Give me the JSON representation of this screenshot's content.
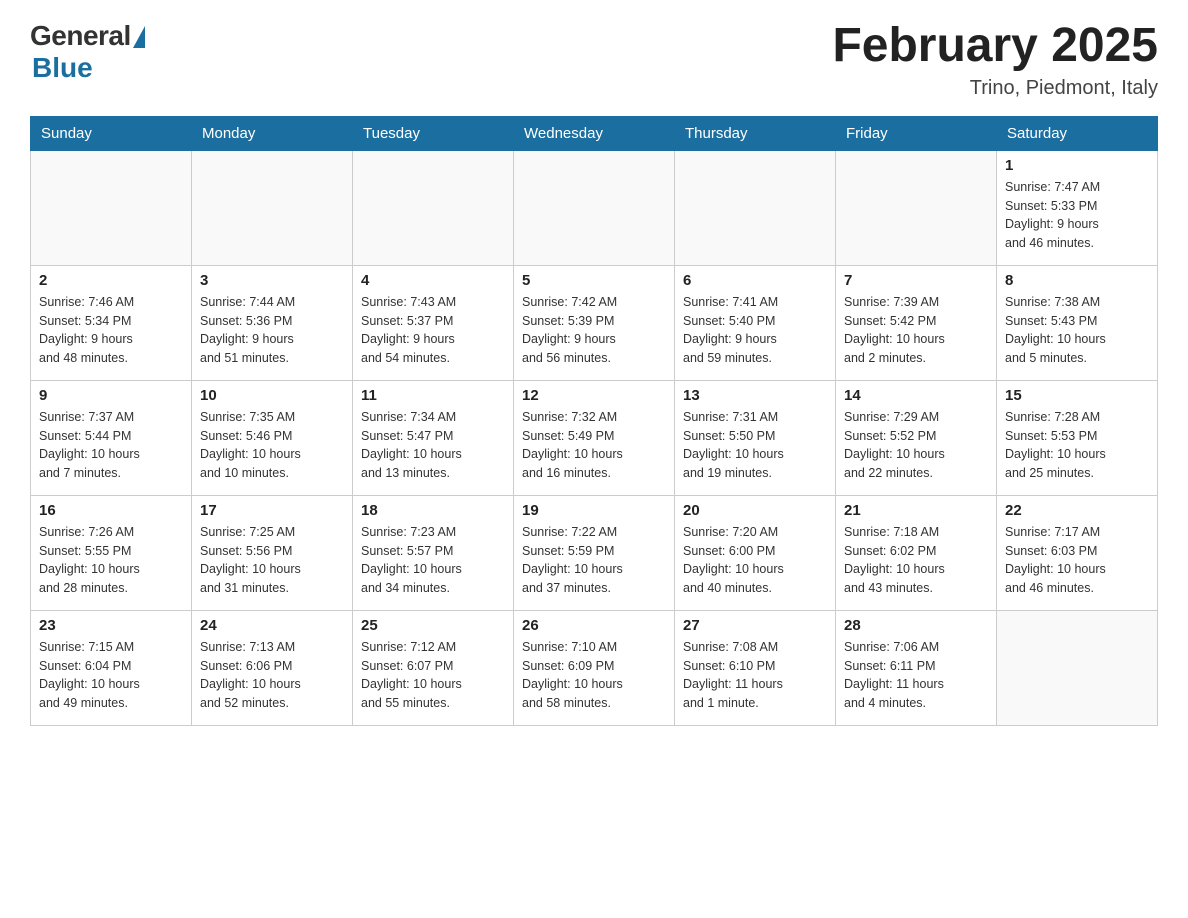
{
  "header": {
    "logo": {
      "general": "General",
      "blue": "Blue",
      "subtitle": "Blue"
    },
    "title": "February 2025",
    "location": "Trino, Piedmont, Italy"
  },
  "days_of_week": [
    "Sunday",
    "Monday",
    "Tuesday",
    "Wednesday",
    "Thursday",
    "Friday",
    "Saturday"
  ],
  "weeks": [
    [
      {
        "day": "",
        "info": ""
      },
      {
        "day": "",
        "info": ""
      },
      {
        "day": "",
        "info": ""
      },
      {
        "day": "",
        "info": ""
      },
      {
        "day": "",
        "info": ""
      },
      {
        "day": "",
        "info": ""
      },
      {
        "day": "1",
        "info": "Sunrise: 7:47 AM\nSunset: 5:33 PM\nDaylight: 9 hours\nand 46 minutes."
      }
    ],
    [
      {
        "day": "2",
        "info": "Sunrise: 7:46 AM\nSunset: 5:34 PM\nDaylight: 9 hours\nand 48 minutes."
      },
      {
        "day": "3",
        "info": "Sunrise: 7:44 AM\nSunset: 5:36 PM\nDaylight: 9 hours\nand 51 minutes."
      },
      {
        "day": "4",
        "info": "Sunrise: 7:43 AM\nSunset: 5:37 PM\nDaylight: 9 hours\nand 54 minutes."
      },
      {
        "day": "5",
        "info": "Sunrise: 7:42 AM\nSunset: 5:39 PM\nDaylight: 9 hours\nand 56 minutes."
      },
      {
        "day": "6",
        "info": "Sunrise: 7:41 AM\nSunset: 5:40 PM\nDaylight: 9 hours\nand 59 minutes."
      },
      {
        "day": "7",
        "info": "Sunrise: 7:39 AM\nSunset: 5:42 PM\nDaylight: 10 hours\nand 2 minutes."
      },
      {
        "day": "8",
        "info": "Sunrise: 7:38 AM\nSunset: 5:43 PM\nDaylight: 10 hours\nand 5 minutes."
      }
    ],
    [
      {
        "day": "9",
        "info": "Sunrise: 7:37 AM\nSunset: 5:44 PM\nDaylight: 10 hours\nand 7 minutes."
      },
      {
        "day": "10",
        "info": "Sunrise: 7:35 AM\nSunset: 5:46 PM\nDaylight: 10 hours\nand 10 minutes."
      },
      {
        "day": "11",
        "info": "Sunrise: 7:34 AM\nSunset: 5:47 PM\nDaylight: 10 hours\nand 13 minutes."
      },
      {
        "day": "12",
        "info": "Sunrise: 7:32 AM\nSunset: 5:49 PM\nDaylight: 10 hours\nand 16 minutes."
      },
      {
        "day": "13",
        "info": "Sunrise: 7:31 AM\nSunset: 5:50 PM\nDaylight: 10 hours\nand 19 minutes."
      },
      {
        "day": "14",
        "info": "Sunrise: 7:29 AM\nSunset: 5:52 PM\nDaylight: 10 hours\nand 22 minutes."
      },
      {
        "day": "15",
        "info": "Sunrise: 7:28 AM\nSunset: 5:53 PM\nDaylight: 10 hours\nand 25 minutes."
      }
    ],
    [
      {
        "day": "16",
        "info": "Sunrise: 7:26 AM\nSunset: 5:55 PM\nDaylight: 10 hours\nand 28 minutes."
      },
      {
        "day": "17",
        "info": "Sunrise: 7:25 AM\nSunset: 5:56 PM\nDaylight: 10 hours\nand 31 minutes."
      },
      {
        "day": "18",
        "info": "Sunrise: 7:23 AM\nSunset: 5:57 PM\nDaylight: 10 hours\nand 34 minutes."
      },
      {
        "day": "19",
        "info": "Sunrise: 7:22 AM\nSunset: 5:59 PM\nDaylight: 10 hours\nand 37 minutes."
      },
      {
        "day": "20",
        "info": "Sunrise: 7:20 AM\nSunset: 6:00 PM\nDaylight: 10 hours\nand 40 minutes."
      },
      {
        "day": "21",
        "info": "Sunrise: 7:18 AM\nSunset: 6:02 PM\nDaylight: 10 hours\nand 43 minutes."
      },
      {
        "day": "22",
        "info": "Sunrise: 7:17 AM\nSunset: 6:03 PM\nDaylight: 10 hours\nand 46 minutes."
      }
    ],
    [
      {
        "day": "23",
        "info": "Sunrise: 7:15 AM\nSunset: 6:04 PM\nDaylight: 10 hours\nand 49 minutes."
      },
      {
        "day": "24",
        "info": "Sunrise: 7:13 AM\nSunset: 6:06 PM\nDaylight: 10 hours\nand 52 minutes."
      },
      {
        "day": "25",
        "info": "Sunrise: 7:12 AM\nSunset: 6:07 PM\nDaylight: 10 hours\nand 55 minutes."
      },
      {
        "day": "26",
        "info": "Sunrise: 7:10 AM\nSunset: 6:09 PM\nDaylight: 10 hours\nand 58 minutes."
      },
      {
        "day": "27",
        "info": "Sunrise: 7:08 AM\nSunset: 6:10 PM\nDaylight: 11 hours\nand 1 minute."
      },
      {
        "day": "28",
        "info": "Sunrise: 7:06 AM\nSunset: 6:11 PM\nDaylight: 11 hours\nand 4 minutes."
      },
      {
        "day": "",
        "info": ""
      }
    ]
  ]
}
